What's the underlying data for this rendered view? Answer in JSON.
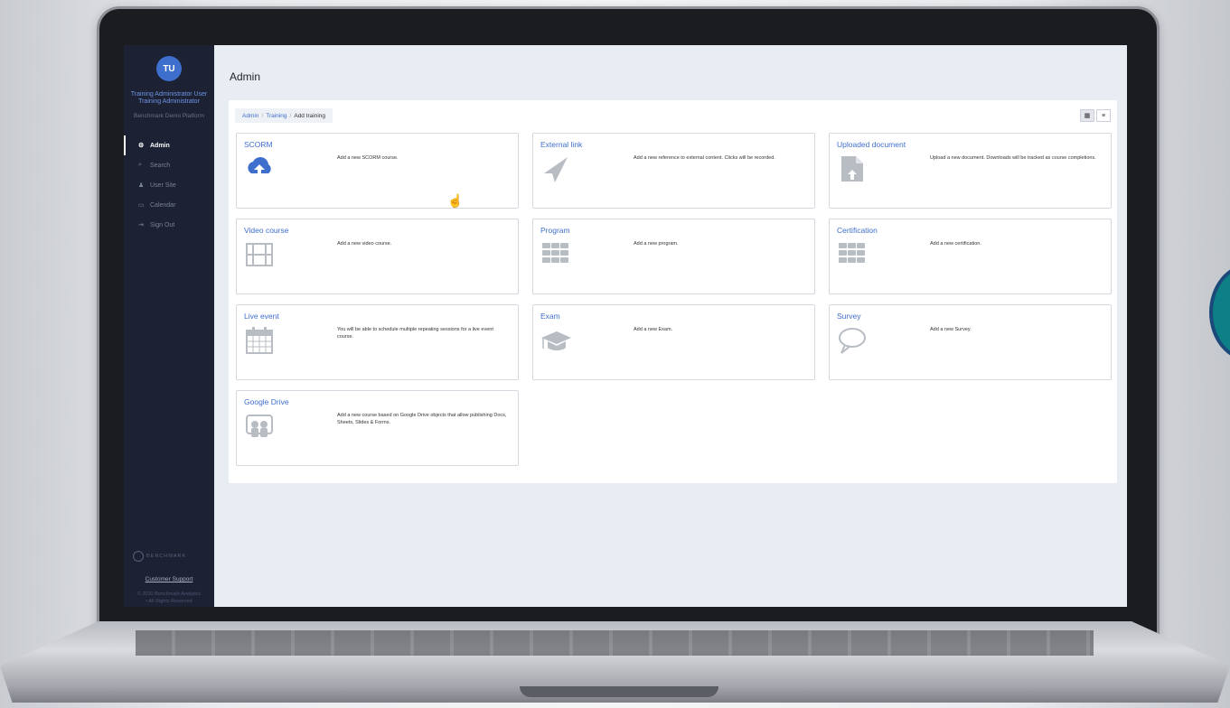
{
  "user": {
    "initials": "TU",
    "name": "Training Administrator User",
    "role": "Training Administrator",
    "platform": "Benchmark Demo Platform"
  },
  "nav": [
    {
      "label": "Admin",
      "icon": "gear-icon",
      "active": true
    },
    {
      "label": "Search",
      "icon": "search-icon",
      "active": false
    },
    {
      "label": "User Site",
      "icon": "user-icon",
      "active": false
    },
    {
      "label": "Calendar",
      "icon": "calendar-icon",
      "active": false
    },
    {
      "label": "Sign Out",
      "icon": "sign-out-icon",
      "active": false
    }
  ],
  "sidebar_footer": {
    "logo": "BENCHMARK",
    "support": "Customer Support",
    "copyright_line1": "© 2020 Benchmark Analytics",
    "copyright_line2": "• All Rights Reserved"
  },
  "page": {
    "title": "Admin",
    "breadcrumb": [
      {
        "label": "Admin",
        "link": true
      },
      {
        "label": "Training",
        "link": true
      },
      {
        "label": "Add training",
        "link": false
      }
    ],
    "view_toggle": {
      "grid": "▦",
      "list": "≡"
    }
  },
  "cards": [
    {
      "title": "SCORM",
      "icon": "cloud-upload-icon",
      "description": "Add a new SCORM course."
    },
    {
      "title": "External link",
      "icon": "paper-plane-icon",
      "description": "Add a new reference to external content. Clicks will be recorded."
    },
    {
      "title": "Uploaded document",
      "icon": "document-upload-icon",
      "description": "Upload a new document. Downloads will be tracked as course completions."
    },
    {
      "title": "Video course",
      "icon": "film-icon",
      "description": "Add a new video course."
    },
    {
      "title": "Program",
      "icon": "grid-icon",
      "description": "Add a new program."
    },
    {
      "title": "Certification",
      "icon": "grid-icon",
      "description": "Add a new certification."
    },
    {
      "title": "Live event",
      "icon": "calendar-icon",
      "description": "You will be able to schedule multiple repeating sessions for a live event course."
    },
    {
      "title": "Exam",
      "icon": "graduation-cap-icon",
      "description": "Add a new Exam."
    },
    {
      "title": "Survey",
      "icon": "speech-bubble-icon",
      "description": "Add a new Survey."
    },
    {
      "title": "Google Drive",
      "icon": "google-drive-icon",
      "description": "Add a new course based on Google Drive objects that allow publishing Docs, Sheets, Slides & Forms."
    }
  ],
  "colors": {
    "accent": "#3f6fcc",
    "sidebar": "#1c2133",
    "screen_bg": "#e8edf3"
  }
}
